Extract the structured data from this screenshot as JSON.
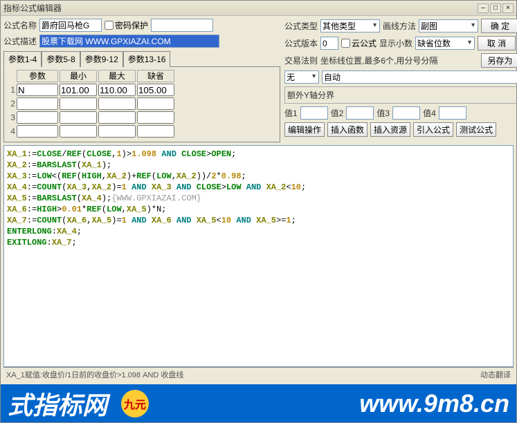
{
  "window": {
    "title": "指标公式编辑器"
  },
  "labels": {
    "name": "公式名称",
    "pwd": "密码保护",
    "type": "公式类型",
    "draw": "画线方法",
    "desc": "公式描述",
    "ver": "公式版本",
    "cloud": "云公式",
    "dec": "显示小数",
    "defdec": "缺省位数",
    "rule": "交易法则",
    "coord": "坐标线位置,最多6个,用分号分隔",
    "extray": "额外Y轴分界",
    "v1": "值1",
    "v2": "值2",
    "v3": "值3",
    "v4": "值4",
    "auto": "自动"
  },
  "fields": {
    "name": "爵府回马枪G",
    "desc": "股票下载网 WWW.GPXIAZAI.COM",
    "type": "其他类型",
    "draw": "副图",
    "ver": "0",
    "rule": "无"
  },
  "buttons": {
    "ok": "确   定",
    "cancel": "取   消",
    "saveas": "另存为",
    "editop": "编辑操作",
    "insfn": "插入函数",
    "insres": "插入资源",
    "import": "引入公式",
    "test": "测试公式"
  },
  "tabs": {
    "t1": "参数1-4",
    "t2": "参数5-8",
    "t3": "参数9-12",
    "t4": "参数13-16"
  },
  "phead": {
    "name": "参数",
    "min": "最小",
    "max": "最大",
    "def": "缺省"
  },
  "prows": [
    {
      "idx": "1",
      "name": "N",
      "min": "101.00",
      "max": "110.00",
      "def": "105.00"
    },
    {
      "idx": "2",
      "name": "",
      "min": "",
      "max": "",
      "def": ""
    },
    {
      "idx": "3",
      "name": "",
      "min": "",
      "max": "",
      "def": ""
    },
    {
      "idx": "4",
      "name": "",
      "min": "",
      "max": "",
      "def": ""
    }
  ],
  "code_lines": [
    [
      [
        "var",
        "XA_1"
      ],
      [
        "",
        ":="
      ],
      [
        "fn",
        "CLOSE"
      ],
      [
        "",
        "/"
      ],
      [
        "fn",
        "REF"
      ],
      [
        "",
        "("
      ],
      [
        "fn",
        "CLOSE"
      ],
      [
        "",
        ","
      ],
      [
        "num",
        "1"
      ],
      [
        "",
        ")>"
      ],
      [
        "num",
        "1.098"
      ],
      [
        "kw",
        " AND "
      ],
      [
        "fn",
        "CLOSE"
      ],
      [
        "",
        ">"
      ],
      [
        "fn",
        "OPEN"
      ],
      [
        "",
        ";"
      ]
    ],
    [
      [
        "var",
        "XA_2"
      ],
      [
        "",
        ":="
      ],
      [
        "fn",
        "BARSLAST"
      ],
      [
        "",
        "("
      ],
      [
        "var",
        "XA_1"
      ],
      [
        "",
        ");"
      ]
    ],
    [
      [
        "var",
        "XA_3"
      ],
      [
        "",
        ":="
      ],
      [
        "fn",
        "LOW"
      ],
      [
        "",
        "<("
      ],
      [
        "fn",
        "REF"
      ],
      [
        "",
        "("
      ],
      [
        "fn",
        "HIGH"
      ],
      [
        "",
        ","
      ],
      [
        "var",
        "XA_2"
      ],
      [
        "",
        ")+"
      ],
      [
        "fn",
        "REF"
      ],
      [
        "",
        "("
      ],
      [
        "fn",
        "LOW"
      ],
      [
        "",
        ","
      ],
      [
        "var",
        "XA_2"
      ],
      [
        "",
        "))/"
      ],
      [
        "num",
        "2"
      ],
      [
        "",
        "*"
      ],
      [
        "num",
        "0.98"
      ],
      [
        "",
        ";"
      ]
    ],
    [
      [
        "var",
        "XA_4"
      ],
      [
        "",
        ":="
      ],
      [
        "fn",
        "COUNT"
      ],
      [
        "",
        "("
      ],
      [
        "var",
        "XA_3"
      ],
      [
        "",
        ","
      ],
      [
        "var",
        "XA_2"
      ],
      [
        "",
        ")="
      ],
      [
        "num",
        "1"
      ],
      [
        "kw",
        " AND "
      ],
      [
        "var",
        "XA_3"
      ],
      [
        "kw",
        " AND "
      ],
      [
        "fn",
        "CLOSE"
      ],
      [
        "",
        ">"
      ],
      [
        "fn",
        "LOW"
      ],
      [
        "kw",
        " AND "
      ],
      [
        "var",
        "XA_2"
      ],
      [
        "",
        "<"
      ],
      [
        "num",
        "10"
      ],
      [
        "",
        ";"
      ]
    ],
    [
      [
        "var",
        "XA_5"
      ],
      [
        "",
        ":="
      ],
      [
        "fn",
        "BARSLAST"
      ],
      [
        "",
        "("
      ],
      [
        "var",
        "XA_4"
      ],
      [
        "",
        ");"
      ],
      [
        "cmt",
        "{WWW.GPXIAZAI.COM}"
      ]
    ],
    [
      [
        "var",
        "XA_6"
      ],
      [
        "",
        ":="
      ],
      [
        "fn",
        "HIGH"
      ],
      [
        "",
        ">"
      ],
      [
        "num",
        "0.01"
      ],
      [
        "",
        "*"
      ],
      [
        "fn",
        "REF"
      ],
      [
        "",
        "("
      ],
      [
        "fn",
        "LOW"
      ],
      [
        "",
        ","
      ],
      [
        "var",
        "XA_5"
      ],
      [
        "",
        ")*N;"
      ]
    ],
    [
      [
        "var",
        "XA_7"
      ],
      [
        "",
        ":="
      ],
      [
        "fn",
        "COUNT"
      ],
      [
        "",
        "("
      ],
      [
        "var",
        "XA_6"
      ],
      [
        "",
        ","
      ],
      [
        "var",
        "XA_5"
      ],
      [
        "",
        ")="
      ],
      [
        "num",
        "1"
      ],
      [
        "kw",
        " AND "
      ],
      [
        "var",
        "XA_6"
      ],
      [
        "kw",
        " AND "
      ],
      [
        "var",
        "XA_5"
      ],
      [
        "",
        "<"
      ],
      [
        "num",
        "10"
      ],
      [
        "kw",
        " AND "
      ],
      [
        "var",
        "XA_5"
      ],
      [
        "",
        ">="
      ],
      [
        "num",
        "1"
      ],
      [
        "",
        ";"
      ]
    ],
    [
      [
        "fn",
        "ENTERLONG"
      ],
      [
        "",
        ":"
      ],
      [
        "var",
        "XA_4"
      ],
      [
        "",
        ";"
      ]
    ],
    [
      [
        "fn",
        "EXITLONG"
      ],
      [
        "",
        ":"
      ],
      [
        "var",
        "XA_7"
      ],
      [
        "",
        ";"
      ]
    ]
  ],
  "status": {
    "left": "XA_1赋值:收盘价/1日前的收盘价>1.098 AND 收盘线",
    "right": "动态翻译"
  },
  "footer": {
    "left": "式指标网",
    "right": "www.9m8.cn",
    "logo": "九元"
  }
}
